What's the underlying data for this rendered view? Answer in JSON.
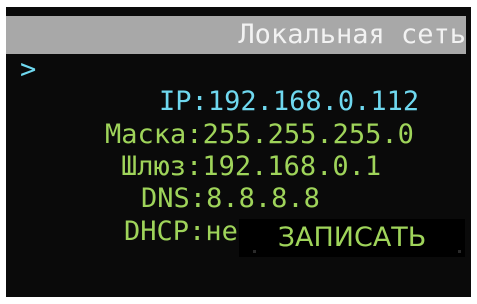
{
  "header": {
    "title": "Локальная сеть"
  },
  "menu": {
    "cursor": ">",
    "ip": {
      "label": "IP:",
      "value": "192.168.0.112"
    },
    "mask": {
      "label": "Маска:",
      "value": "255.255.255.0"
    },
    "gateway": {
      "label": "Шлюз:",
      "value": "192.168.0.1"
    },
    "dns": {
      "label": "DNS:",
      "value": "8.8.8.8"
    },
    "dhcp": {
      "label": "DHCP:",
      "value": "нет"
    }
  },
  "actions": {
    "write_label": "ЗАПИСАТЬ"
  },
  "colors": {
    "background": "#0a0a0a",
    "header_bg": "#a8a8a8",
    "header_text": "#f2f2f2",
    "item_text": "#9fd45a",
    "selected_text": "#6fd8ef"
  }
}
